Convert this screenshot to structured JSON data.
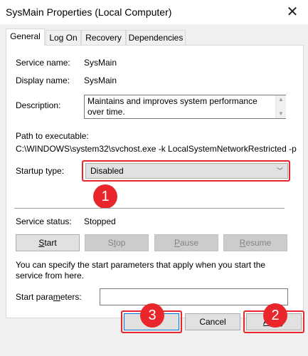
{
  "window": {
    "title": "SysMain Properties (Local Computer)"
  },
  "tabs": [
    {
      "label": "General"
    },
    {
      "label": "Log On"
    },
    {
      "label": "Recovery"
    },
    {
      "label": "Dependencies"
    }
  ],
  "general": {
    "service_name_label": "Service name:",
    "service_name": "SysMain",
    "display_name_label": "Display name:",
    "display_name": "SysMain",
    "description_label": "Description:",
    "description": "Maintains and improves system performance over time.",
    "path_label": "Path to executable:",
    "path": "C:\\WINDOWS\\system32\\svchost.exe -k LocalSystemNetworkRestricted -p",
    "startup_type_label": "Startup type:",
    "startup_type": "Disabled",
    "service_status_label": "Service status:",
    "service_status": "Stopped",
    "start_button": {
      "label_pre": "",
      "accel": "S",
      "label_post": "tart"
    },
    "stop_button": {
      "label_pre": "S",
      "accel": "t",
      "label_post": "op"
    },
    "pause_button": {
      "label_pre": "",
      "accel": "P",
      "label_post": "ause"
    },
    "resume_button": {
      "label_pre": "",
      "accel": "R",
      "label_post": "esume"
    },
    "hint": "You can specify the start parameters that apply when you start the service from here.",
    "start_params_label": "Start para",
    "start_params_accel": "m",
    "start_params_label_post": "eters:",
    "start_params_value": ""
  },
  "footer": {
    "ok": "OK",
    "cancel": "Cancel",
    "apply_pre": "",
    "apply_accel": "A",
    "apply_post": "pply"
  },
  "callouts": [
    "1",
    "2",
    "3"
  ],
  "colors": {
    "callout_red": "#e8262b",
    "dialog_bg": "#f0f0f0"
  }
}
